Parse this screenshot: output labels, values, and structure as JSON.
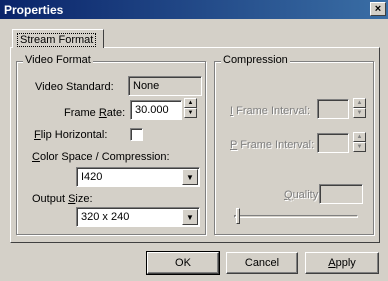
{
  "window": {
    "title": "Properties",
    "close_glyph": "×"
  },
  "tabs": [
    {
      "label": "Stream Format"
    }
  ],
  "video_format": {
    "group_title": "Video Format",
    "standard_label": "Video Standard:",
    "standard_value": "None",
    "frame_rate_label_pre": "Frame ",
    "frame_rate_label_key": "R",
    "frame_rate_label_post": "ate:",
    "frame_rate_value": "30.000",
    "flip_label_key": "F",
    "flip_label_post": "lip Horizontal:",
    "flip_checked": false,
    "color_space_label_key": "C",
    "color_space_label_post": "olor Space / Compression:",
    "color_space_value": "I420",
    "output_size_label_pre": "Output ",
    "output_size_label_key": "S",
    "output_size_label_post": "ize:",
    "output_size_value": "320 x 240"
  },
  "compression": {
    "group_title": "Compression",
    "i_frame_label_key": "I",
    "i_frame_label_post": " Frame Interval:",
    "i_frame_value": "",
    "p_frame_label_key": "P",
    "p_frame_label_post": " Frame Interval:",
    "p_frame_value": "",
    "quality_label_key": "Q",
    "quality_label_post": "uality:",
    "quality_value": ""
  },
  "buttons": {
    "ok": "OK",
    "cancel": "Cancel",
    "apply_key": "A",
    "apply_post": "pply"
  },
  "icons": {
    "spin_up": "▲",
    "spin_down": "▼",
    "dropdown": "▼"
  }
}
